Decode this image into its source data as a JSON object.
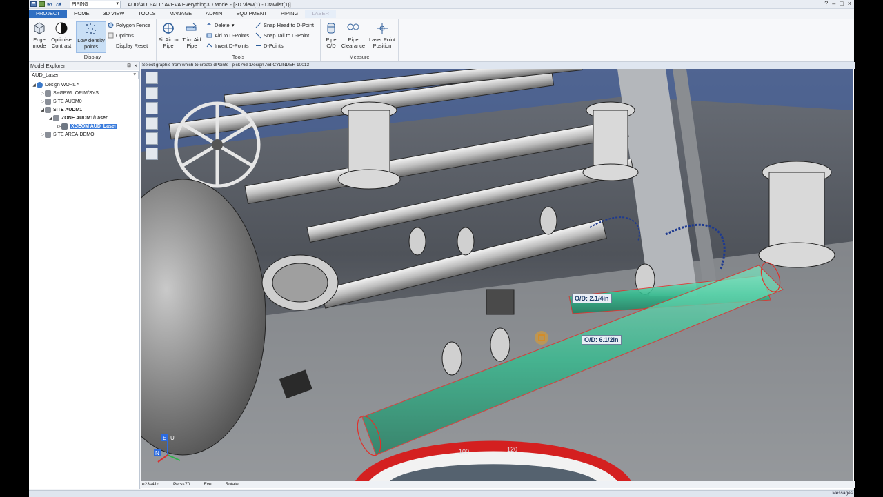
{
  "window": {
    "title": "AUD/AUD-ALL: AVEVA Everything3D Model - [3D View(1) - Drawlist(1)]",
    "module_select": "PIPING"
  },
  "ribbon_tabs": [
    "PROJECT",
    "HOME",
    "3D VIEW",
    "TOOLS",
    "MANAGE",
    "ADMIN",
    "EQUIPMENT",
    "PIPING",
    "LASER"
  ],
  "ribbon": {
    "display": {
      "label": "Display",
      "edge_mode": "Edge mode",
      "optimise_contrast": "Optimise Contrast",
      "low_density_points": "Low density points",
      "polygon_fence": "Polygon Fence",
      "options": "Options",
      "display_reset": "Display Reset"
    },
    "tools": {
      "label": "Tools",
      "fit_aid_to_pipe": "Fit Aid to Pipe",
      "trim_aid_pipe": "Trim Aid Pipe",
      "delete": "Delete",
      "aid_to_dpoints": "Aid to D-Points",
      "invert_dpoints": "Invert D-Points",
      "snap_head": "Snap Head to D-Point",
      "snap_tail": "Snap Tail to D-Point",
      "dpoints": "D-Points"
    },
    "measure": {
      "label": "Measure",
      "pipe_od": "Pipe O/D",
      "pipe_clearance": "Pipe Clearance",
      "laser_point_position": "Laser Point Position"
    }
  },
  "explorer": {
    "title": "Model Explorer",
    "select_value": "AUD_Laser",
    "nodes": [
      {
        "label": "Design WORL *",
        "toggle": "◢",
        "color": "#3a78c8"
      },
      {
        "label": "SYGPWL ORIM/SYS",
        "toggle": "▷",
        "color": "#8a8f98"
      },
      {
        "label": "SITE AUDM0",
        "toggle": "▷",
        "color": "#8a8f98"
      },
      {
        "label": "SITE AUDM1",
        "toggle": "◢",
        "color": "#8a8f98"
      },
      {
        "label": "ZONE AUDM1/Laser",
        "toggle": "◢",
        "color": "#8a8f98"
      },
      {
        "label": "XGEOM AUD_Laser",
        "toggle": "▷",
        "color": "#6f7884"
      },
      {
        "label": "SITE AREA-DEMO",
        "toggle": "▷",
        "color": "#8a8f98"
      }
    ]
  },
  "viewport": {
    "prompt": "Select graphic from which to create dPoints : pick Aid :Design Aid CYLINDER 10013",
    "labels": {
      "od_small": "O/D: 2.1/4in",
      "od_large": "O/D: 6.1/2in"
    },
    "gauge_ticks": [
      "100",
      "120"
    ],
    "axis": {
      "e": "E",
      "u": "U",
      "n": "N"
    },
    "status": [
      "e23s41d",
      "Pers<70",
      "Eve",
      "Rotate"
    ]
  },
  "bottom_bar": {
    "messages": "Messages"
  },
  "colors": {
    "accent": "#2f6fc2",
    "cylinder": "#2fbf8f",
    "cylinder_outline": "#e0302a",
    "gauge_red": "#d42020"
  }
}
